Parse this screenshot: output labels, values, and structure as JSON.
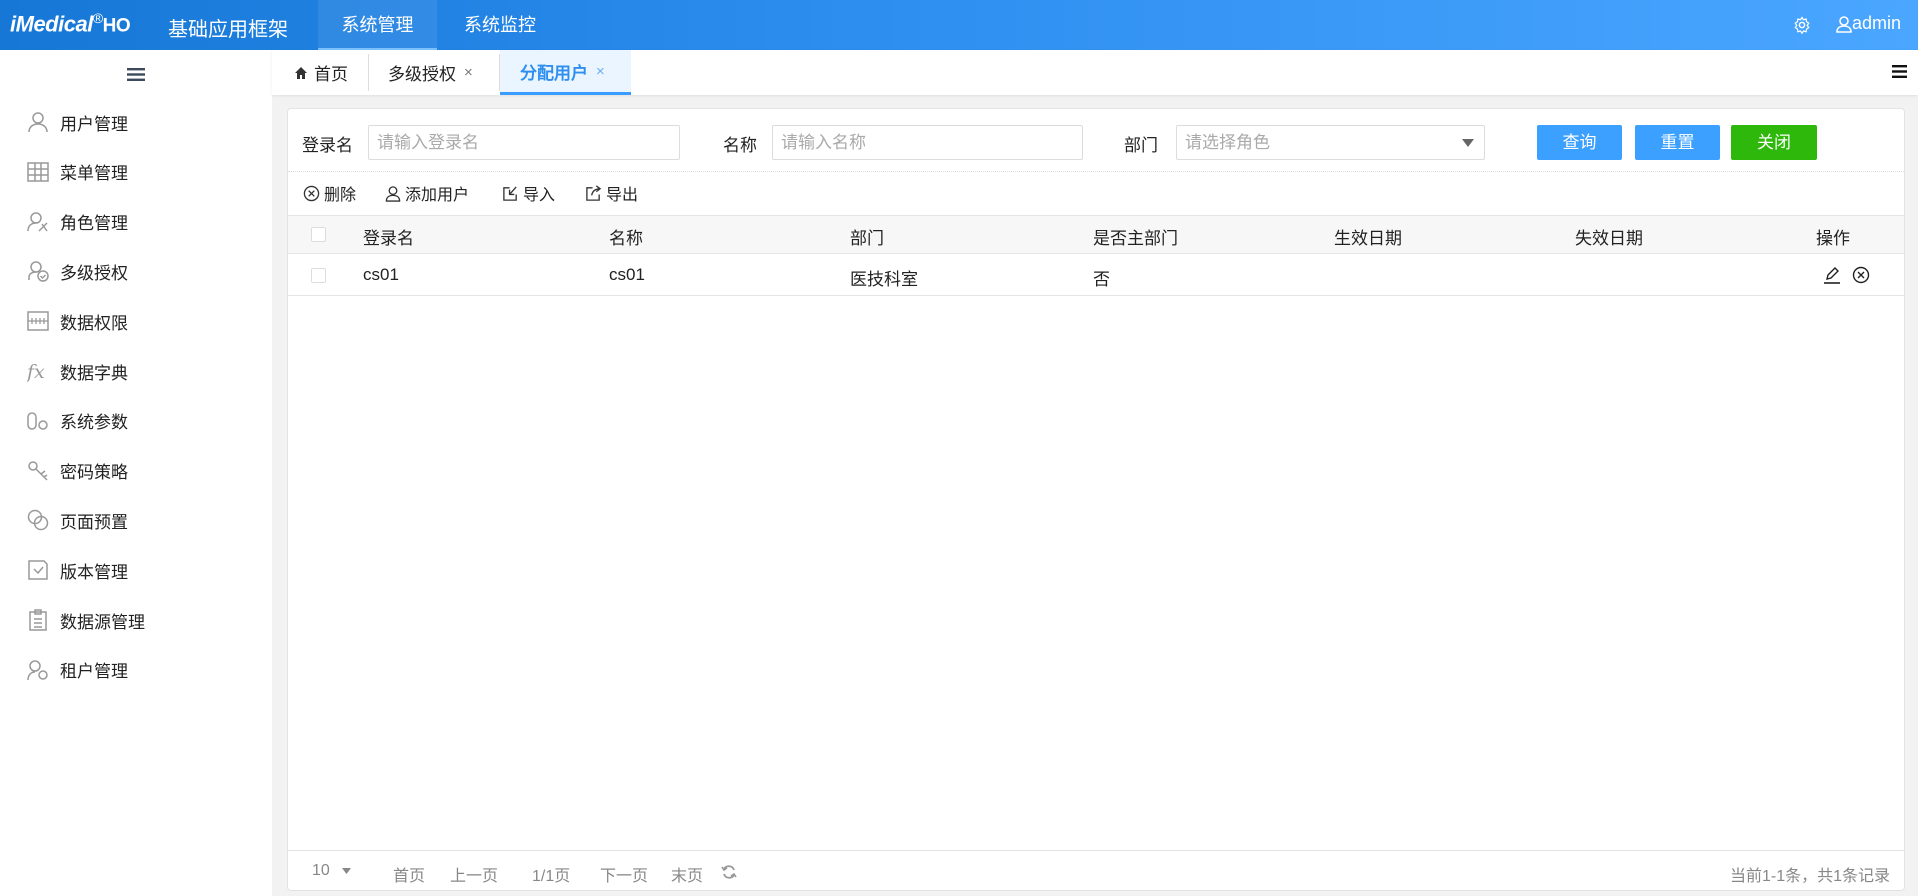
{
  "header": {
    "logo": "iMedical",
    "logo_reg": "®",
    "logo_suffix": "HO",
    "app_title": "基础应用框架",
    "nav": [
      {
        "label": "系统管理",
        "active": true
      },
      {
        "label": "系统监控",
        "active": false
      }
    ],
    "user": "admin"
  },
  "sidebar": {
    "items": [
      {
        "label": "用户管理",
        "icon": "user-icon"
      },
      {
        "label": "菜单管理",
        "icon": "grid-icon"
      },
      {
        "label": "角色管理",
        "icon": "role-icon"
      },
      {
        "label": "多级授权",
        "icon": "user-check-icon"
      },
      {
        "label": "数据权限",
        "icon": "data-permission-icon"
      },
      {
        "label": "数据字典",
        "icon": "fx-icon"
      },
      {
        "label": "系统参数",
        "icon": "params-icon"
      },
      {
        "label": "密码策略",
        "icon": "key-icon"
      },
      {
        "label": "页面预置",
        "icon": "circles-icon"
      },
      {
        "label": "版本管理",
        "icon": "version-icon"
      },
      {
        "label": "数据源管理",
        "icon": "clipboard-icon"
      },
      {
        "label": "租户管理",
        "icon": "tenant-icon"
      }
    ]
  },
  "tabs": [
    {
      "label": "首页",
      "closable": false
    },
    {
      "label": "多级授权",
      "closable": true
    },
    {
      "label": "分配用户",
      "closable": true,
      "active": true
    }
  ],
  "close_glyph": "×",
  "filter": {
    "login_label": "登录名",
    "login_placeholder": "请输入登录名",
    "name_label": "名称",
    "name_placeholder": "请输入名称",
    "dept_label": "部门",
    "dept_placeholder": "请选择角色",
    "query": "查询",
    "reset": "重置",
    "close": "关闭"
  },
  "toolbar": {
    "delete": "删除",
    "add_user": "添加用户",
    "import": "导入",
    "export": "导出"
  },
  "table": {
    "columns": [
      "登录名",
      "名称",
      "部门",
      "是否主部门",
      "生效日期",
      "失效日期",
      "操作"
    ],
    "rows": [
      {
        "login": "cs01",
        "name": "cs01",
        "dept": "医技科室",
        "primary": "否",
        "start": "",
        "end": ""
      }
    ]
  },
  "pager": {
    "page_size": "10",
    "first": "首页",
    "prev": "上一页",
    "page": "1/1页",
    "next": "下一页",
    "last": "末页",
    "summary": "当前1-1条，共1条记录"
  },
  "colors": {
    "primary": "#3ba0ff",
    "success": "#2db80b",
    "header_start": "#1677d6",
    "header_end": "#4aa6ff"
  }
}
